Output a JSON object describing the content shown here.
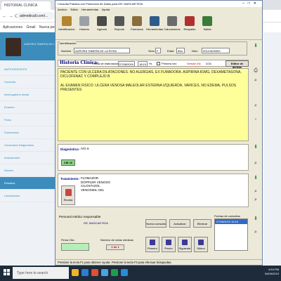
{
  "browser": {
    "tab_title": "HISTORIAL CLINICA",
    "url": "admedicall.com/...",
    "bookmarks": [
      "Aplicaciones",
      "Gmail",
      "Nueva pestaña"
    ]
  },
  "webpage": {
    "banner_text": "AURORA TAMERA DE LA ROSA",
    "menu": [
      "ANTECEDENTES",
      "Consulta",
      "Interrogatorio Inicial",
      "Examen",
      "Pulso",
      "Exploración",
      "Conclusión Diagnóstica",
      "Indicaciones",
      "Receta",
      "Estudios",
      "Laboratorios"
    ]
  },
  "app": {
    "title": "Consulta Práctica con Protección de Datos para DR. MASCAR ROA",
    "menu": [
      "Archivo",
      "Editar",
      "Herramientas",
      "Ayuda"
    ],
    "toolbar": [
      {
        "label": "Identificación",
        "color": "#b5842e"
      },
      {
        "label": "Historia",
        "color": "#9aa0a6"
      },
      {
        "label": "Agenda",
        "color": "#4a4a4a"
      },
      {
        "label": "Reporte",
        "color": "#555555"
      },
      {
        "label": "Fármacos",
        "color": "#8a6d3b"
      },
      {
        "label": "Herramientas",
        "color": "#2e5c8a"
      },
      {
        "label": "Calculadoras",
        "color": "#6b6b6b"
      },
      {
        "label": "Respaldo",
        "color": "#b03030"
      },
      {
        "label": "Salida",
        "color": "#3a7a3a"
      }
    ],
    "identificacion": {
      "group_title": "Identificación",
      "nombre_label": "Nombre",
      "nombre": "AURORA TAMERA DE LA ROSA",
      "sexo_label": "Sexo",
      "sexo": "F",
      "edad_label": "Edad",
      "edad": "55a",
      "num_label": "Núm",
      "num": "00121825303"
    },
    "historia": {
      "title": "Historia Clínica:",
      "fecha_label": "Fecha de elaboración:",
      "fecha": "27/08/2019",
      "hora": "18:19",
      "hrs": "Hr.",
      "primera_label": "Primera vez",
      "version_label": "Versión Ed:",
      "version": "2/24",
      "alertas_button": "Editor de alertas",
      "text": [
        "PACIENTE CON ULCERA  DILATACIONES. NO ALERGIAS, EX FUMADORA. ASPIRINA 81MG, DEXAMETASONA, DICLOFENAC Y COMPLEJO B",
        "AL EXAMEN FISICO: ULCERA VENOSA MALEOLAR ESTERNA IZQUIERDA,  VARICES, NO EDEMA, PULSOS PRESENTES"
      ]
    },
    "diagnostico": {
      "label": "Diagnóstico:",
      "text": "IVG 6",
      "code": "CIE 10"
    },
    "tratamiento": {
      "label": "Tratamiento:",
      "items": [
        "FLOMAZOR",
        "DOPPLER VENOSO",
        "CILOSTAZOL",
        "VENOSMIL GEL"
      ],
      "receta_button": "Receta"
    },
    "medico": {
      "label": "Personal médico responsable",
      "value": "DR. MASCAR ROA"
    },
    "firma_label": "Firma Cita",
    "notas": {
      "label": "Número de notas médicas",
      "value": "1 de 1"
    },
    "actions": [
      "Nueva consulta",
      "Actualizar",
      "Eliminar"
    ],
    "nav": [
      "Primero",
      "Previo",
      "Siguiente",
      "Último"
    ],
    "fechas": {
      "label": "Fechas de consultas",
      "selected": "27/08/2019 18:19"
    },
    "status": "Presione la tecla F1 para obtener ayuda. Presione la tecla F3 para efectuar búsquedas."
  },
  "taskbar": {
    "search_placeholder": "Type here to search",
    "time": "4:54 PM",
    "date": "06/09/2019",
    "icon_colors": [
      "#f0b429",
      "#2d7dd2",
      "#e04e39",
      "#4aa3df",
      "#1c9d4e",
      "#2a8bd8"
    ]
  }
}
